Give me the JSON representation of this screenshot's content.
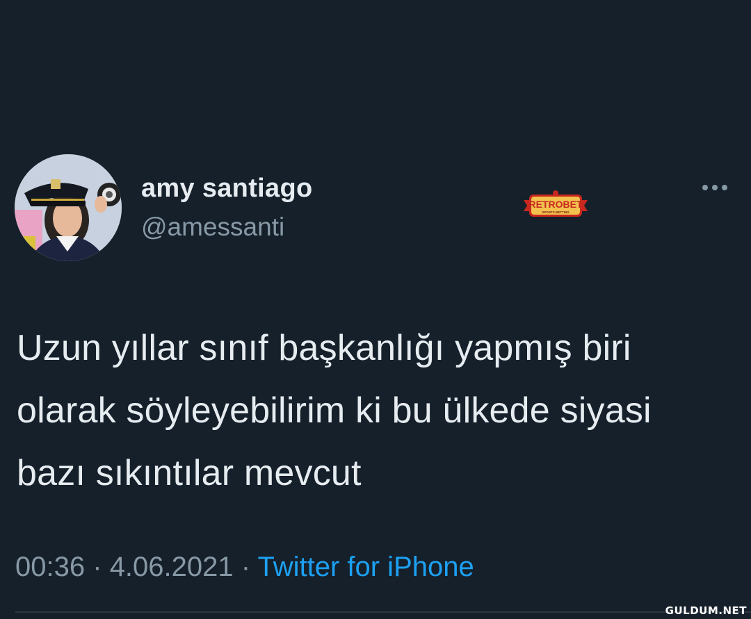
{
  "tweet": {
    "display_name": "amy santiago",
    "handle": "@amessanti",
    "text_lines": [
      "Uzun yıllar sınıf başkanlığı yapmış biri",
      "olarak söyleyebilirim ki bu ülkede siyasi",
      "bazı sıkıntılar mevcut"
    ],
    "time": "00:36",
    "separator": "·",
    "date": "4.06.2021",
    "source": "Twitter for iPhone"
  },
  "overlay_logo": {
    "text": "RETROBET",
    "subtext": "SPORTS BETTING"
  },
  "watermark": "GULDUM.NET",
  "colors": {
    "background": "#15202b",
    "primary_text": "#e6ecf0",
    "secondary_text": "#8899a6",
    "link": "#1da1f2",
    "logo_red": "#c8281e",
    "logo_yellow": "#f2c14e"
  },
  "icons": {
    "more": "more-horizontal-icon"
  }
}
